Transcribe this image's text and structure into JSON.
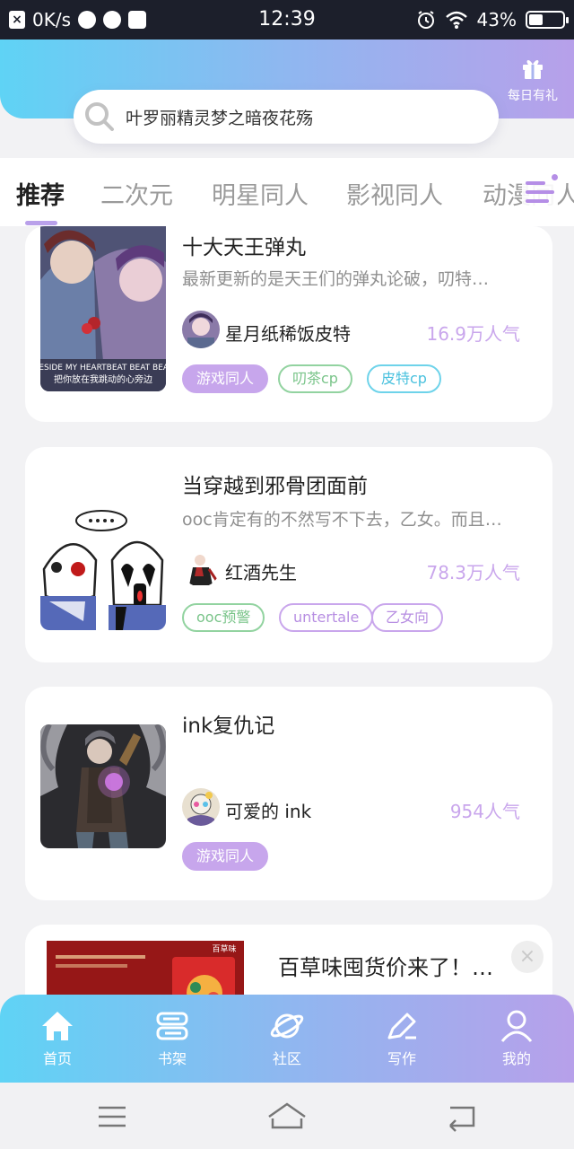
{
  "status_bar": {
    "net_speed": "0K/s",
    "time": "12:39",
    "battery_percent": "43%",
    "battery_level": 0.43
  },
  "header": {
    "gift_label": "每日有礼"
  },
  "search": {
    "text": "叶罗丽精灵梦之暗夜花殇"
  },
  "tabs": [
    {
      "label": "推荐",
      "active": true
    },
    {
      "label": "二次元"
    },
    {
      "label": "明星同人"
    },
    {
      "label": "影视同人"
    },
    {
      "label": "动漫同人"
    }
  ],
  "cards": [
    {
      "title": "十大天王弹丸",
      "desc": "最新更新的是天王们的弹丸论破，叨特…",
      "author": "星月纸稀饭皮特",
      "popularity": "16.9万人气",
      "cover_caption": "BESIDE MY HEARTBEAT BEAT BEAT",
      "cover_caption_zh": "把你放在我跳动的心旁边",
      "tags": [
        "游戏同人",
        "叨茶cp",
        "皮特cp"
      ]
    },
    {
      "title": "当穿越到邪骨团面前",
      "desc": "ooc肯定有的不然写不下去，乙女。而且…",
      "author": "红酒先生",
      "popularity": "78.3万人气",
      "tags": [
        "ooc预警",
        "untertale",
        "乙女向"
      ]
    },
    {
      "title": "ink复仇记",
      "desc": "",
      "author": "可爱的 ink",
      "popularity": "954人气",
      "tags": [
        "游戏同人"
      ]
    }
  ],
  "ad": {
    "title": "百草味囤货价来了！…",
    "brand": "百草味",
    "close": "×"
  },
  "bottom_nav": [
    {
      "label": "首页",
      "icon": "home-icon",
      "active": true
    },
    {
      "label": "书架",
      "icon": "bookshelf-icon"
    },
    {
      "label": "社区",
      "icon": "planet-icon"
    },
    {
      "label": "写作",
      "icon": "pen-icon"
    },
    {
      "label": "我的",
      "icon": "user-icon"
    }
  ],
  "colors": {
    "gradient_start": "#5fd3f5",
    "gradient_end": "#b7a0ea",
    "accent_purple": "#c7a6ec",
    "popularity": "#c9a6ec"
  }
}
